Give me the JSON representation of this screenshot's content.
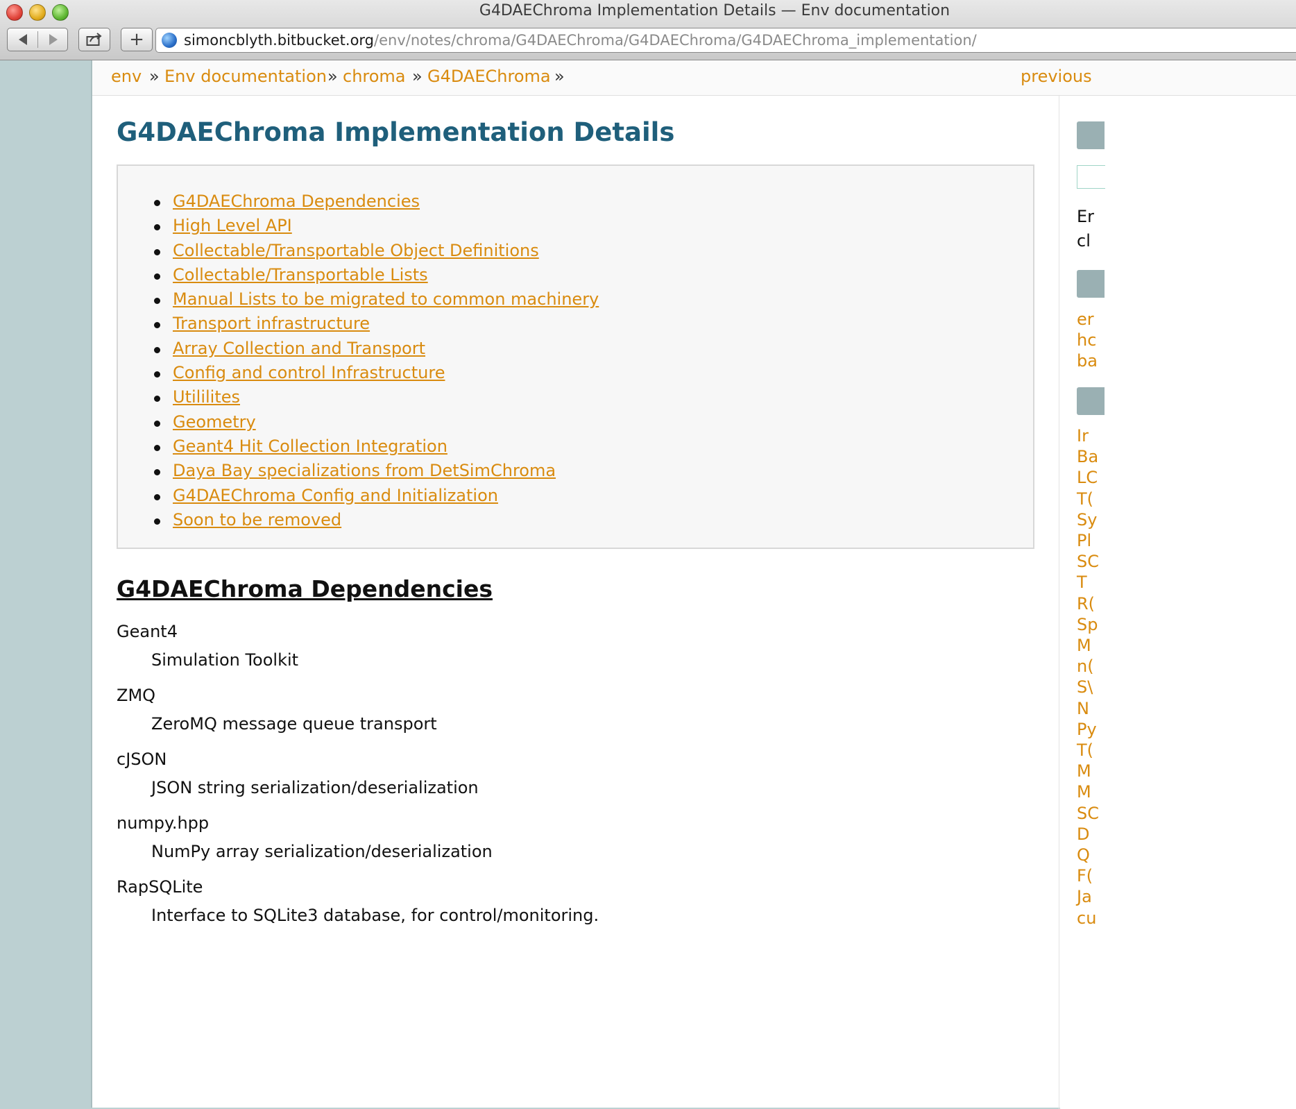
{
  "window": {
    "title": "G4DAEChroma Implementation Details — Env documentation"
  },
  "address": {
    "host": "simoncblyth.bitbucket.org",
    "path": "/env/notes/chroma/G4DAEChroma/G4DAEChroma/G4DAEChroma_implementation/"
  },
  "breadcrumbs": {
    "items": [
      "env",
      "Env documentation",
      "chroma",
      "G4DAEChroma"
    ],
    "separator": "»",
    "previous": "previous"
  },
  "page": {
    "title": "G4DAEChroma Implementation Details"
  },
  "toc": [
    "G4DAEChroma Dependencies",
    "High Level API",
    "Collectable/Transportable Object Definitions",
    "Collectable/Transportable Lists",
    "Manual Lists to be migrated to common machinery",
    "Transport infrastructure",
    "Array Collection and Transport",
    "Config and control Infrastructure",
    "Utililites",
    "Geometry",
    "Geant4 Hit Collection Integration",
    "Daya Bay specializations from DetSimChroma",
    "G4DAEChroma Config and Initialization",
    "Soon to be removed"
  ],
  "dependencies": {
    "heading": "G4DAEChroma Dependencies",
    "items": [
      {
        "term": "Geant4",
        "desc": "Simulation Toolkit"
      },
      {
        "term": "ZMQ",
        "desc": "ZeroMQ message queue transport"
      },
      {
        "term": "cJSON",
        "desc": "JSON string serialization/deserialization"
      },
      {
        "term": "numpy.hpp",
        "desc": "NumPy array serialization/deserialization"
      },
      {
        "term": "RapSQLite",
        "desc": "Interface to SQLite3 database, for control/monitoring."
      }
    ]
  },
  "sidebar": {
    "dark_fragments": [
      "Er",
      "cl"
    ],
    "orange_fragments_a": [
      "er",
      "hc",
      "ba"
    ],
    "orange_fragments_b": [
      "Ir",
      "Ba",
      "LC",
      "T(",
      "Sy",
      "Pl",
      "SC",
      "T",
      "R(",
      "Sp",
      "M",
      "n(",
      "S\\",
      "N",
      "Py",
      "T(",
      "M",
      "M",
      "SC",
      "D",
      "Q",
      "F(",
      "Ja",
      "cu"
    ]
  },
  "colors": {
    "link": "#d98b0f",
    "title": "#1f5f7b",
    "sidebar_bg": "#bcd0d2"
  }
}
